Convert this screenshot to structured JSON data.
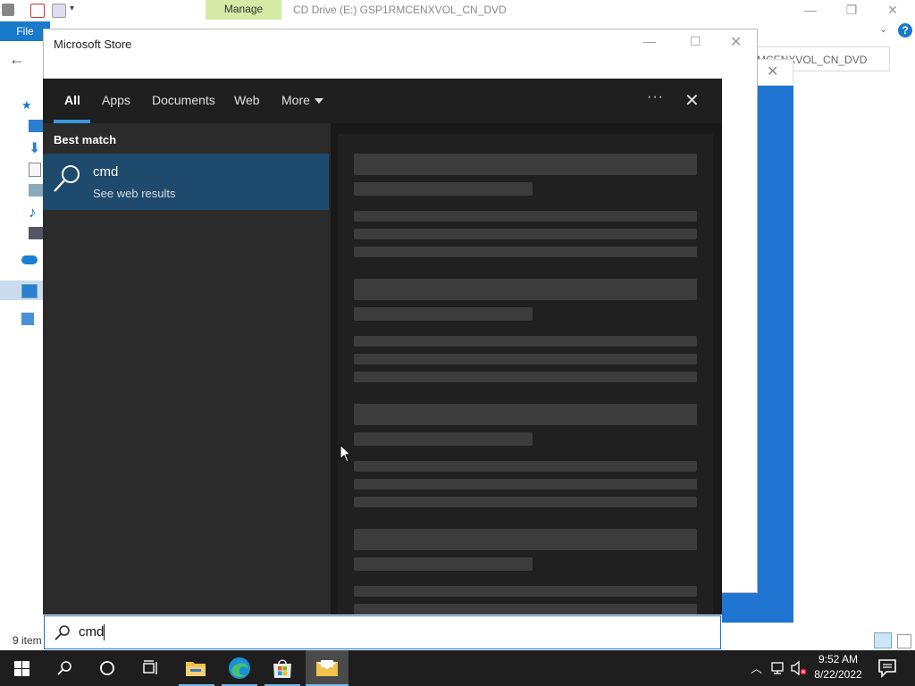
{
  "explorer": {
    "context_tab": "Manage",
    "title": "CD Drive (E:) GSP1RMCENXVOL_CN_DVD",
    "file_tab": "File",
    "address_fragment": "MCENXVOL_CN_DVD",
    "status_count": "9 item"
  },
  "store": {
    "title": "Microsoft Store"
  },
  "search": {
    "tabs": {
      "all": "All",
      "apps": "Apps",
      "documents": "Documents",
      "web": "Web",
      "more": "More"
    },
    "section_heading": "Best match",
    "result": {
      "title": "cmd",
      "subtitle": "See web results"
    },
    "query": "cmd",
    "accent_color": "#3a96dd",
    "selected_bg": "#1e4a6e"
  },
  "taskbar": {
    "time": "9:52 AM",
    "date": "8/22/2022",
    "icons": [
      "windows-start-icon",
      "search-icon",
      "cortana-icon",
      "task-view-icon",
      "file-explorer-icon",
      "edge-icon",
      "store-icon",
      "mail-icon"
    ]
  }
}
